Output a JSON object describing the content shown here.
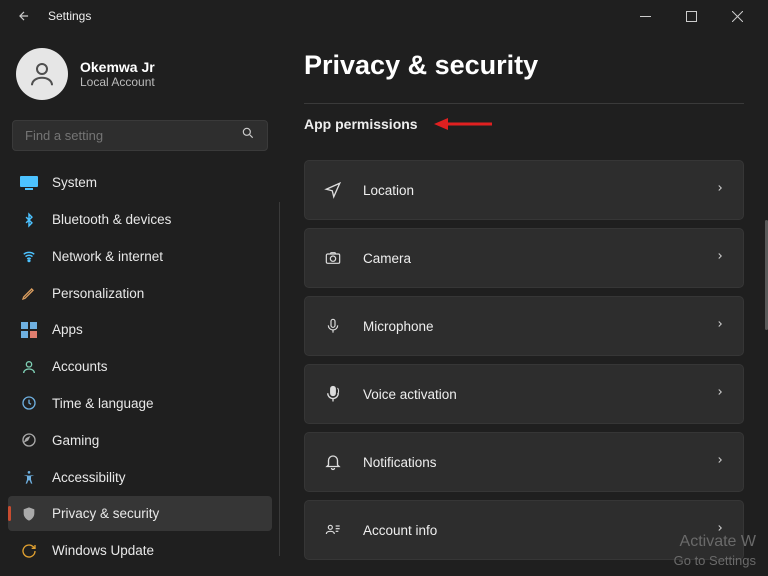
{
  "window": {
    "title": "Settings"
  },
  "account": {
    "name": "Okemwa Jr",
    "type": "Local Account"
  },
  "search": {
    "placeholder": "Find a setting"
  },
  "sidebar": {
    "items": [
      {
        "label": "System"
      },
      {
        "label": "Bluetooth & devices"
      },
      {
        "label": "Network & internet"
      },
      {
        "label": "Personalization"
      },
      {
        "label": "Apps"
      },
      {
        "label": "Accounts"
      },
      {
        "label": "Time & language"
      },
      {
        "label": "Gaming"
      },
      {
        "label": "Accessibility"
      },
      {
        "label": "Privacy & security"
      },
      {
        "label": "Windows Update"
      }
    ]
  },
  "page": {
    "title": "Privacy & security",
    "section": "App permissions",
    "permissions": [
      {
        "label": "Location"
      },
      {
        "label": "Camera"
      },
      {
        "label": "Microphone"
      },
      {
        "label": "Voice activation"
      },
      {
        "label": "Notifications"
      },
      {
        "label": "Account info"
      }
    ]
  },
  "watermark": {
    "line1": "Activate W",
    "line2": "Go to Settings"
  }
}
